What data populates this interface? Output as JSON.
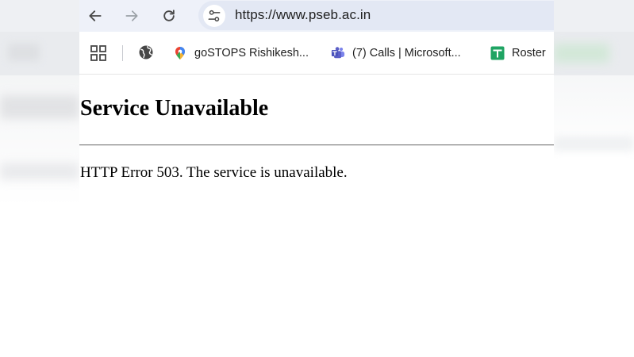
{
  "browser": {
    "url": "https://www.pseb.ac.in",
    "bookmarks": [
      {
        "label": "goSTOPS Rishikesh...",
        "icon": "gostops-icon"
      },
      {
        "label": "(7) Calls | Microsoft...",
        "icon": "teams-icon"
      },
      {
        "label": "Roster",
        "icon": "sheets-icon"
      }
    ]
  },
  "page": {
    "heading": "Service Unavailable",
    "message": "HTTP Error 503. The service is unavailable."
  },
  "colors": {
    "toolbar_bg": "#eef1f9",
    "omnibox_bg": "#e3e8f4",
    "teams_purple": "#5b5fc7",
    "sheets_green": "#1fa463"
  }
}
